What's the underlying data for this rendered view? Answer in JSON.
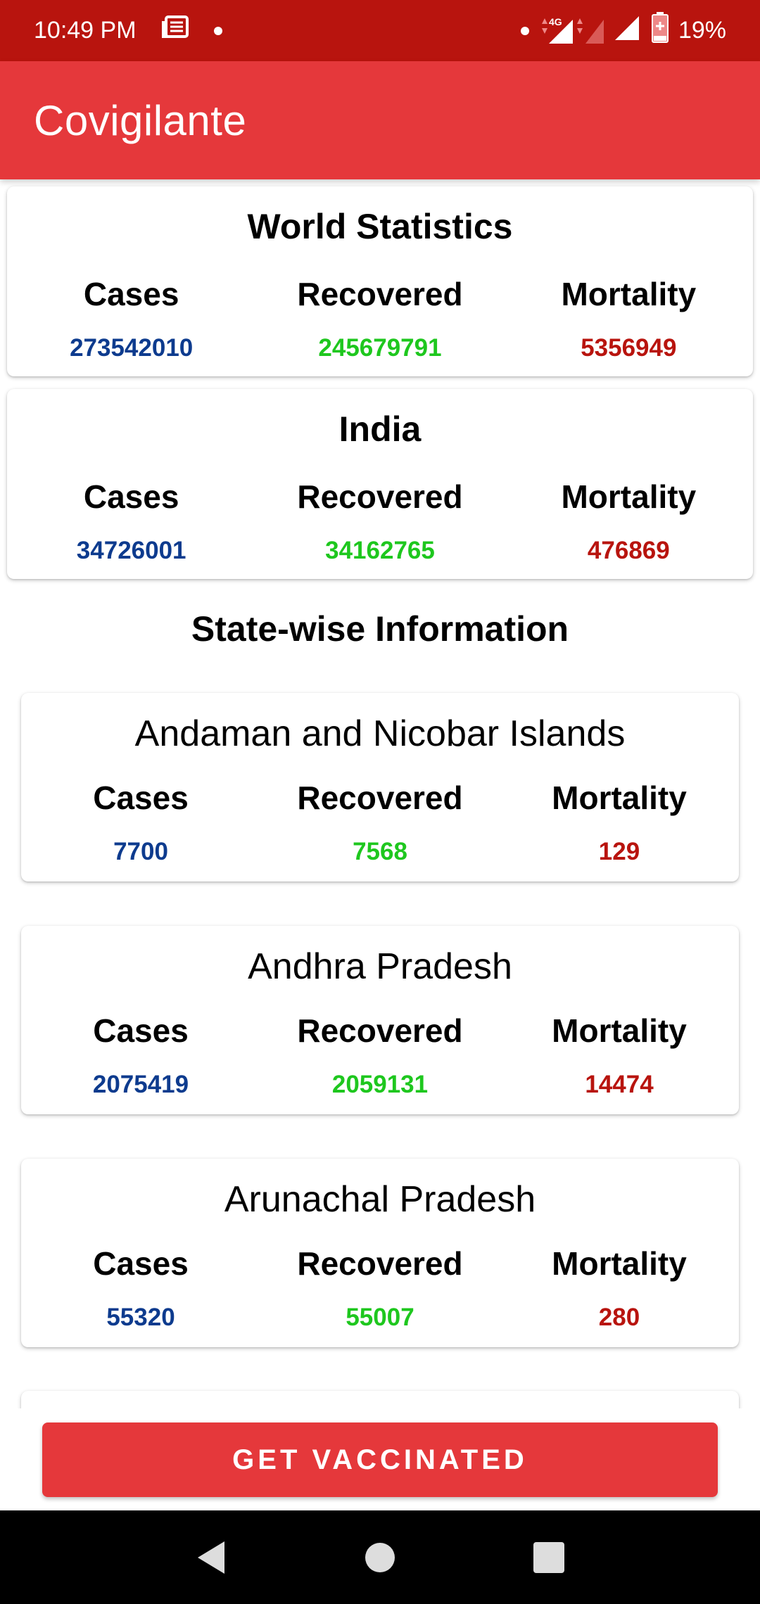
{
  "status_bar": {
    "time": "10:49 PM",
    "network": "4G",
    "battery": "19%",
    "icons": [
      "news-icon",
      "notification-dot-icon",
      "signal-icon",
      "battery-icon"
    ]
  },
  "app_bar": {
    "title": "Covigilante"
  },
  "world": {
    "title": "World Statistics",
    "labels": {
      "cases": "Cases",
      "recovered": "Recovered",
      "mortality": "Mortality"
    },
    "cases": "273542010",
    "recovered": "245679791",
    "mortality": "5356949"
  },
  "india": {
    "title": "India",
    "labels": {
      "cases": "Cases",
      "recovered": "Recovered",
      "mortality": "Mortality"
    },
    "cases": "34726001",
    "recovered": "34162765",
    "mortality": "476869"
  },
  "state_section": {
    "heading": "State-wise Information"
  },
  "states": [
    {
      "name": "Andaman and Nicobar Islands",
      "labels": {
        "cases": "Cases",
        "recovered": "Recovered",
        "mortality": "Mortality"
      },
      "cases": "7700",
      "recovered": "7568",
      "mortality": "129"
    },
    {
      "name": "Andhra Pradesh",
      "labels": {
        "cases": "Cases",
        "recovered": "Recovered",
        "mortality": "Mortality"
      },
      "cases": "2075419",
      "recovered": "2059131",
      "mortality": "14474"
    },
    {
      "name": "Arunachal Pradesh",
      "labels": {
        "cases": "Cases",
        "recovered": "Recovered",
        "mortality": "Mortality"
      },
      "cases": "55320",
      "recovered": "55007",
      "mortality": "280"
    }
  ],
  "actions": {
    "vaccinate": "GET VACCINATED"
  },
  "nav": {
    "icons": [
      "back-icon",
      "home-icon",
      "recents-icon"
    ]
  },
  "colors": {
    "status_bar": "#b8140e",
    "app_bar": "#e5383b",
    "cases": "#0d3b8e",
    "recovered": "#1ec71e",
    "mortality": "#b8140e"
  }
}
